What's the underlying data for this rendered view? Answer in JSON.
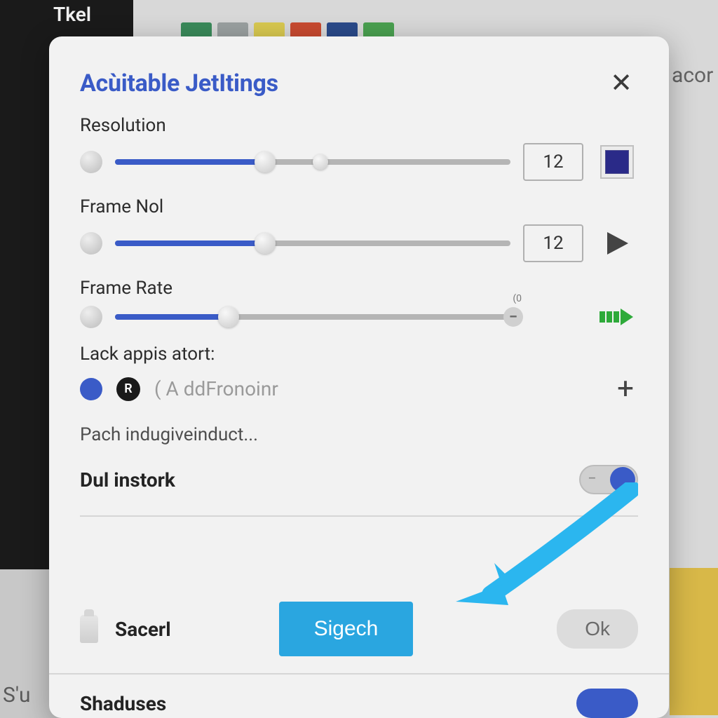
{
  "background": {
    "dark_tab": "Tkel",
    "right_text": "acor",
    "bottom_text": "S'u",
    "chips": [
      "#3a8a5a",
      "#9aa0a0",
      "#d8c850",
      "#c84a30",
      "#2a4a8a",
      "#4aa050"
    ]
  },
  "modal": {
    "title": "Acùitable JetItings",
    "close_label": "✕"
  },
  "settings": {
    "resolution": {
      "label": "Resolution",
      "value": "12",
      "fill_pct": 38,
      "thumb_pct": 38,
      "thumb2_pct": 52,
      "swatch_color": "#2a2a88"
    },
    "frame_nol": {
      "label": "Frame Nol",
      "value": "12",
      "fill_pct": 38,
      "thumb_pct": 38
    },
    "frame_rate": {
      "label": "Frame Rate",
      "value": "",
      "fill_pct": 28,
      "thumb_pct": 28,
      "end_text": "(0"
    }
  },
  "lack_section": {
    "label": "Lack appis atort:",
    "badge": "R",
    "placeholder": "( A ddFronoinr"
  },
  "text_line": "Pach indugiveinduct...",
  "toggle1": {
    "label": "Dul instork",
    "on": true
  },
  "actions": {
    "sacerl": "Sacerl",
    "primary": "Sigech",
    "ok": "Ok"
  },
  "shaduses": {
    "label": "Shaduses",
    "on": true
  },
  "colors": {
    "accent": "#3a5bc7",
    "primary_btn": "#2aa6e0",
    "arrow": "#2bb6ef"
  }
}
